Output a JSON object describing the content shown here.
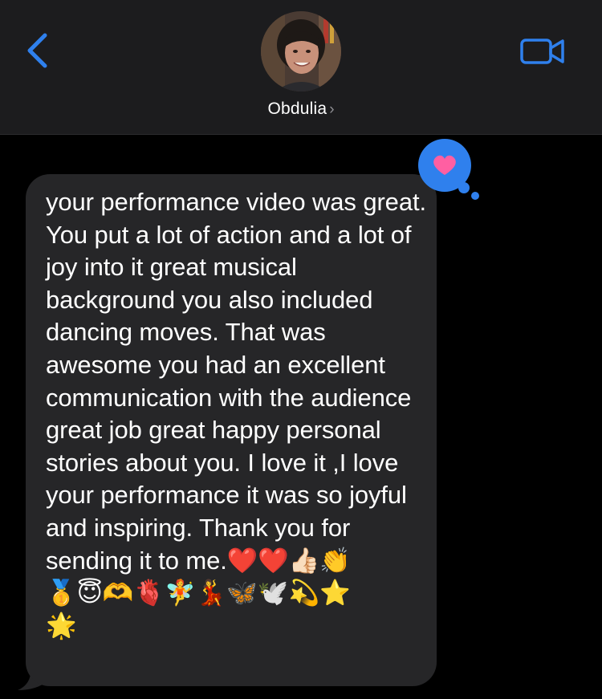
{
  "header": {
    "contact_name": "Obdulia",
    "chevron": "›",
    "back_icon": "chevron-left-icon",
    "video_icon": "video-camera-icon",
    "accent_color": "#2f80ed"
  },
  "message": {
    "text": "your performance video was great. You put a lot of action and a lot of joy into it great musical background  you also included dancing moves. That was awesome you had an excellent communication with the audience great job great happy personal stories about you. I love it ,I love your performance it was so joyful and inspiring. Thank you for sending it to me.",
    "emojis_line1": "❤️❤️👍🏻👏",
    "emojis_line2": "🥇😇🫶🫀🧚💃🦋🕊️💫⭐",
    "emojis_line3": "🌟",
    "bubble_color": "#262628"
  },
  "tapback": {
    "icon": "heart-icon",
    "color": "#2f80ed",
    "heart_color": "#ff5fa2"
  }
}
